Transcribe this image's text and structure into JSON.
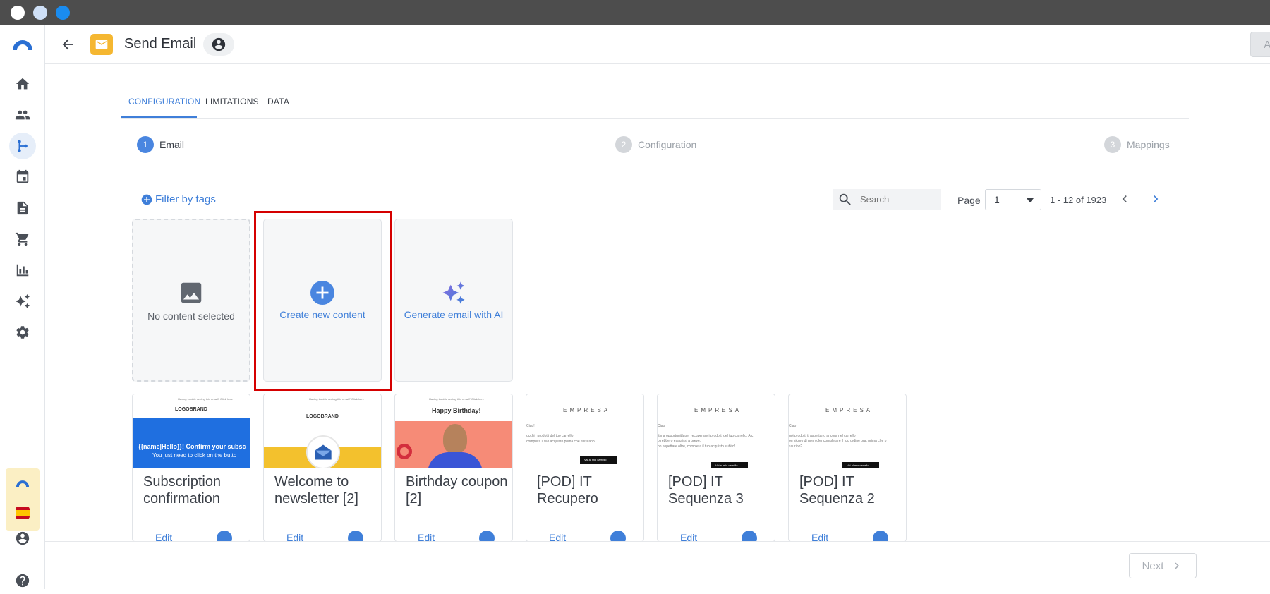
{
  "window": {
    "controls": [
      "close",
      "minimize",
      "maximize"
    ]
  },
  "header": {
    "title": "Send Email",
    "apply_label": "Apply"
  },
  "sidebar": {
    "items": [
      "home",
      "contacts",
      "automation",
      "calendar",
      "documents",
      "ecommerce",
      "reports",
      "ai",
      "settings"
    ],
    "active": "automation",
    "bottom": [
      "account",
      "help"
    ]
  },
  "tabs": [
    {
      "label": "CONFIGURATION",
      "active": true
    },
    {
      "label": "LIMITATIONS",
      "active": false
    },
    {
      "label": "DATA",
      "active": false
    }
  ],
  "steps": [
    {
      "num": "1",
      "label": "Email",
      "active": true
    },
    {
      "num": "2",
      "label": "Configuration",
      "active": false
    },
    {
      "num": "3",
      "label": "Mappings",
      "active": false
    }
  ],
  "toolbar": {
    "filter_label": "Filter by tags",
    "search_placeholder": "Search",
    "page_label": "Page",
    "page_value": "1",
    "range": "1 - 12 of 1923"
  },
  "top_cards": {
    "no_content": "No content selected",
    "create_new": "Create new content",
    "generate_ai": "Generate email with AI"
  },
  "templates": [
    {
      "title": "Subscription confirmation",
      "edit": "Edit",
      "thumb": {
        "brand": "LOGOBRAND",
        "headline": "{{name|Hello}}! Confirm your subsc",
        "sub": "You just need to click on the butto",
        "top": "Having trouble seeing this email? Click here"
      }
    },
    {
      "title": "Welcome to newsletter [2]",
      "edit": "Edit",
      "thumb": {
        "brand": "LOGOBRAND",
        "top": "Having trouble seeing this email? Click here"
      }
    },
    {
      "title": "Birthday coupon [2]",
      "edit": "Edit",
      "thumb": {
        "headline": "Happy Birthday!",
        "top": "Having trouble seeing this email? Click here"
      }
    },
    {
      "title": "[POD] IT Recupero",
      "edit": "Edit",
      "thumb": {
        "brand": "EMPRESA",
        "line1": "Ciao!",
        "line2": "occhi i prodotti del tuo carrello",
        "line3": "completa il tuo acquisto prima che finiscano!",
        "cta": "Vai al mio carrello"
      }
    },
    {
      "title": "[POD] IT Sequenza 3",
      "edit": "Edit",
      "thumb": {
        "brand": "EMPRESA",
        "line1": "Ciao",
        "line2": "ltima opportunità per recuperare i prodotti del tuo carrello. Alc",
        "line3": "otrebbero esaurirsi a breve.",
        "line4": "on aspettare oltre, completa il tuo acquisto subito!",
        "cta": "Vai al mio carrello"
      }
    },
    {
      "title": "[POD] IT Sequenza 2",
      "edit": "Edit",
      "thumb": {
        "brand": "EMPRESA",
        "line1": "Ciao",
        "line2": "uoi prodotti ti aspettano ancora nel carrello",
        "line3": "on sicuro di non voler completare il tuo ordine ora, prima che p",
        "line4": "saurino?",
        "cta": "Vai al mio carrello"
      }
    }
  ],
  "footer": {
    "next_label": "Next"
  },
  "colors": {
    "accent": "#3f7fd9",
    "highlight": "#d50000",
    "badge": "#f5b731"
  }
}
